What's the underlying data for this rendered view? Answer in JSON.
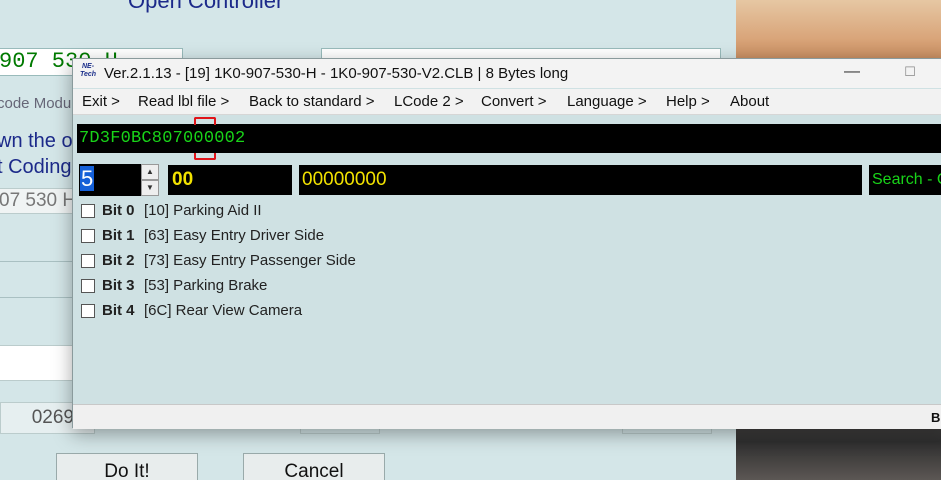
{
  "background_window": {
    "title_fragment": "Open Controller",
    "part_number_field": "907 530 H",
    "code_label": "code Modu",
    "text_down": "wn the or",
    "text_coding": "t Coding",
    "part_number_gray": "07 530 H",
    "number_field": "0269",
    "do_it_button": "Do It!",
    "cancel_button": "Cancel"
  },
  "window": {
    "logo_text": "NE-Tech",
    "title": "Ver.2.1.13 - [19] 1K0-907-530-H - 1K0-907-530-V2.CLB | 8 Bytes long",
    "minimize_glyph": "—",
    "maximize_glyph": "☐"
  },
  "menu": {
    "exit": "Exit >",
    "read_lbl": "Read lbl file >",
    "back_std": "Back to standard >",
    "lcode": "LCode 2 >",
    "convert": "Convert >",
    "language": "Language >",
    "help": "Help >",
    "about": "About"
  },
  "coding": {
    "code_string": "7D3F0BC807000002",
    "byte_index": "5",
    "hex_value": "00",
    "binary_value": "00000000",
    "search_label": "Search - C"
  },
  "bits": [
    {
      "label": "Bit 0",
      "desc": "[10] Parking Aid II",
      "checked": false
    },
    {
      "label": "Bit 1",
      "desc": "[63] Easy Entry Driver Side",
      "checked": false
    },
    {
      "label": "Bit 2",
      "desc": "[73] Easy Entry Passenger Side",
      "checked": false
    },
    {
      "label": "Bit 3",
      "desc": "[53] Parking Brake",
      "checked": false
    },
    {
      "label": "Bit 4",
      "desc": "[6C] Rear View Camera",
      "checked": false
    }
  ],
  "statusbar": {
    "text": "B"
  },
  "colors": {
    "code_green": "#19d419",
    "value_yellow": "#f2e200",
    "marker_red": "#e0141a",
    "window_bg": "#cfe1e3"
  }
}
